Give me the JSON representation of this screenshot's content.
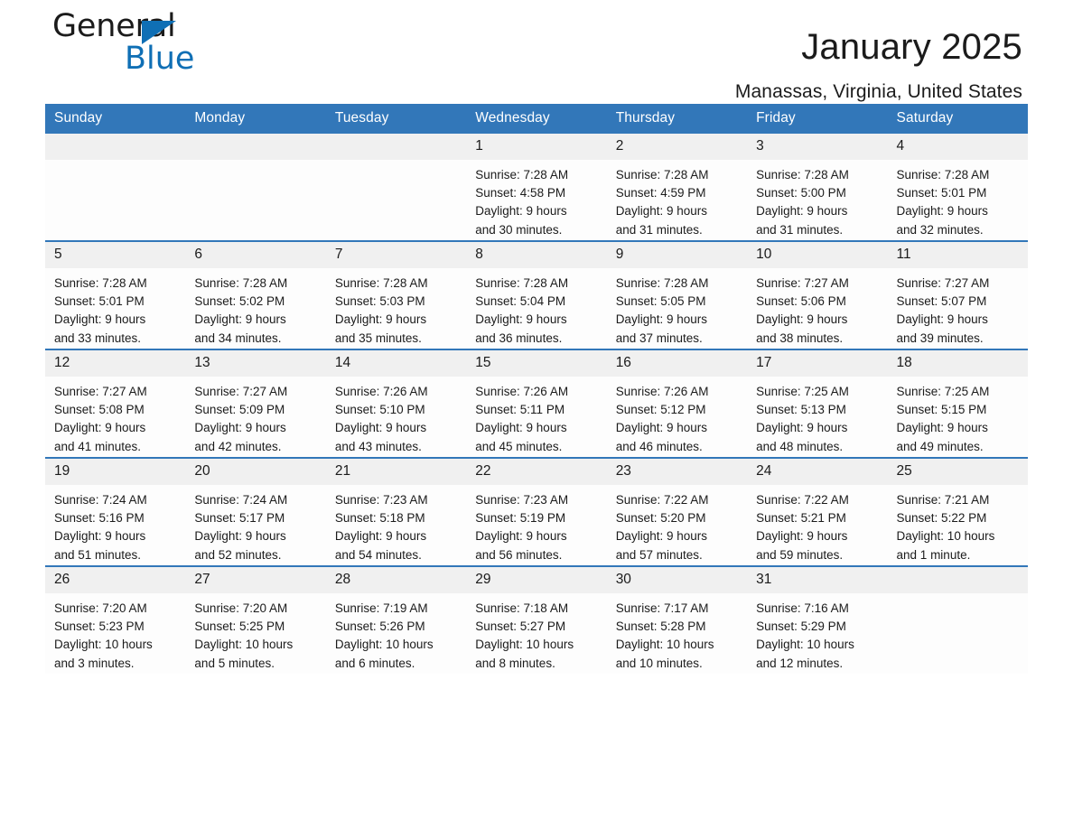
{
  "brand": {
    "name_part1": "General",
    "name_part2": "Blue",
    "triangle_color": "#0f6fb5",
    "text_color": "#1b1b1b"
  },
  "header": {
    "month_title": "January 2025",
    "location": "Manassas, Virginia, United States",
    "header_bg": "#3277b9",
    "header_text": "#ffffff",
    "daynum_bg": "#f0f0f0"
  },
  "weekday_headers": [
    "Sunday",
    "Monday",
    "Tuesday",
    "Wednesday",
    "Thursday",
    "Friday",
    "Saturday"
  ],
  "weeks": [
    [
      {
        "day": "",
        "empty": true,
        "sunrise": "",
        "sunset": "",
        "daylight_line1": "",
        "daylight_line2": ""
      },
      {
        "day": "",
        "empty": true,
        "sunrise": "",
        "sunset": "",
        "daylight_line1": "",
        "daylight_line2": ""
      },
      {
        "day": "",
        "empty": true,
        "sunrise": "",
        "sunset": "",
        "daylight_line1": "",
        "daylight_line2": ""
      },
      {
        "day": "1",
        "empty": false,
        "sunrise": "Sunrise: 7:28 AM",
        "sunset": "Sunset: 4:58 PM",
        "daylight_line1": "Daylight: 9 hours",
        "daylight_line2": "and 30 minutes."
      },
      {
        "day": "2",
        "empty": false,
        "sunrise": "Sunrise: 7:28 AM",
        "sunset": "Sunset: 4:59 PM",
        "daylight_line1": "Daylight: 9 hours",
        "daylight_line2": "and 31 minutes."
      },
      {
        "day": "3",
        "empty": false,
        "sunrise": "Sunrise: 7:28 AM",
        "sunset": "Sunset: 5:00 PM",
        "daylight_line1": "Daylight: 9 hours",
        "daylight_line2": "and 31 minutes."
      },
      {
        "day": "4",
        "empty": false,
        "sunrise": "Sunrise: 7:28 AM",
        "sunset": "Sunset: 5:01 PM",
        "daylight_line1": "Daylight: 9 hours",
        "daylight_line2": "and 32 minutes."
      }
    ],
    [
      {
        "day": "5",
        "empty": false,
        "sunrise": "Sunrise: 7:28 AM",
        "sunset": "Sunset: 5:01 PM",
        "daylight_line1": "Daylight: 9 hours",
        "daylight_line2": "and 33 minutes."
      },
      {
        "day": "6",
        "empty": false,
        "sunrise": "Sunrise: 7:28 AM",
        "sunset": "Sunset: 5:02 PM",
        "daylight_line1": "Daylight: 9 hours",
        "daylight_line2": "and 34 minutes."
      },
      {
        "day": "7",
        "empty": false,
        "sunrise": "Sunrise: 7:28 AM",
        "sunset": "Sunset: 5:03 PM",
        "daylight_line1": "Daylight: 9 hours",
        "daylight_line2": "and 35 minutes."
      },
      {
        "day": "8",
        "empty": false,
        "sunrise": "Sunrise: 7:28 AM",
        "sunset": "Sunset: 5:04 PM",
        "daylight_line1": "Daylight: 9 hours",
        "daylight_line2": "and 36 minutes."
      },
      {
        "day": "9",
        "empty": false,
        "sunrise": "Sunrise: 7:28 AM",
        "sunset": "Sunset: 5:05 PM",
        "daylight_line1": "Daylight: 9 hours",
        "daylight_line2": "and 37 minutes."
      },
      {
        "day": "10",
        "empty": false,
        "sunrise": "Sunrise: 7:27 AM",
        "sunset": "Sunset: 5:06 PM",
        "daylight_line1": "Daylight: 9 hours",
        "daylight_line2": "and 38 minutes."
      },
      {
        "day": "11",
        "empty": false,
        "sunrise": "Sunrise: 7:27 AM",
        "sunset": "Sunset: 5:07 PM",
        "daylight_line1": "Daylight: 9 hours",
        "daylight_line2": "and 39 minutes."
      }
    ],
    [
      {
        "day": "12",
        "empty": false,
        "sunrise": "Sunrise: 7:27 AM",
        "sunset": "Sunset: 5:08 PM",
        "daylight_line1": "Daylight: 9 hours",
        "daylight_line2": "and 41 minutes."
      },
      {
        "day": "13",
        "empty": false,
        "sunrise": "Sunrise: 7:27 AM",
        "sunset": "Sunset: 5:09 PM",
        "daylight_line1": "Daylight: 9 hours",
        "daylight_line2": "and 42 minutes."
      },
      {
        "day": "14",
        "empty": false,
        "sunrise": "Sunrise: 7:26 AM",
        "sunset": "Sunset: 5:10 PM",
        "daylight_line1": "Daylight: 9 hours",
        "daylight_line2": "and 43 minutes."
      },
      {
        "day": "15",
        "empty": false,
        "sunrise": "Sunrise: 7:26 AM",
        "sunset": "Sunset: 5:11 PM",
        "daylight_line1": "Daylight: 9 hours",
        "daylight_line2": "and 45 minutes."
      },
      {
        "day": "16",
        "empty": false,
        "sunrise": "Sunrise: 7:26 AM",
        "sunset": "Sunset: 5:12 PM",
        "daylight_line1": "Daylight: 9 hours",
        "daylight_line2": "and 46 minutes."
      },
      {
        "day": "17",
        "empty": false,
        "sunrise": "Sunrise: 7:25 AM",
        "sunset": "Sunset: 5:13 PM",
        "daylight_line1": "Daylight: 9 hours",
        "daylight_line2": "and 48 minutes."
      },
      {
        "day": "18",
        "empty": false,
        "sunrise": "Sunrise: 7:25 AM",
        "sunset": "Sunset: 5:15 PM",
        "daylight_line1": "Daylight: 9 hours",
        "daylight_line2": "and 49 minutes."
      }
    ],
    [
      {
        "day": "19",
        "empty": false,
        "sunrise": "Sunrise: 7:24 AM",
        "sunset": "Sunset: 5:16 PM",
        "daylight_line1": "Daylight: 9 hours",
        "daylight_line2": "and 51 minutes."
      },
      {
        "day": "20",
        "empty": false,
        "sunrise": "Sunrise: 7:24 AM",
        "sunset": "Sunset: 5:17 PM",
        "daylight_line1": "Daylight: 9 hours",
        "daylight_line2": "and 52 minutes."
      },
      {
        "day": "21",
        "empty": false,
        "sunrise": "Sunrise: 7:23 AM",
        "sunset": "Sunset: 5:18 PM",
        "daylight_line1": "Daylight: 9 hours",
        "daylight_line2": "and 54 minutes."
      },
      {
        "day": "22",
        "empty": false,
        "sunrise": "Sunrise: 7:23 AM",
        "sunset": "Sunset: 5:19 PM",
        "daylight_line1": "Daylight: 9 hours",
        "daylight_line2": "and 56 minutes."
      },
      {
        "day": "23",
        "empty": false,
        "sunrise": "Sunrise: 7:22 AM",
        "sunset": "Sunset: 5:20 PM",
        "daylight_line1": "Daylight: 9 hours",
        "daylight_line2": "and 57 minutes."
      },
      {
        "day": "24",
        "empty": false,
        "sunrise": "Sunrise: 7:22 AM",
        "sunset": "Sunset: 5:21 PM",
        "daylight_line1": "Daylight: 9 hours",
        "daylight_line2": "and 59 minutes."
      },
      {
        "day": "25",
        "empty": false,
        "sunrise": "Sunrise: 7:21 AM",
        "sunset": "Sunset: 5:22 PM",
        "daylight_line1": "Daylight: 10 hours",
        "daylight_line2": "and 1 minute."
      }
    ],
    [
      {
        "day": "26",
        "empty": false,
        "sunrise": "Sunrise: 7:20 AM",
        "sunset": "Sunset: 5:23 PM",
        "daylight_line1": "Daylight: 10 hours",
        "daylight_line2": "and 3 minutes."
      },
      {
        "day": "27",
        "empty": false,
        "sunrise": "Sunrise: 7:20 AM",
        "sunset": "Sunset: 5:25 PM",
        "daylight_line1": "Daylight: 10 hours",
        "daylight_line2": "and 5 minutes."
      },
      {
        "day": "28",
        "empty": false,
        "sunrise": "Sunrise: 7:19 AM",
        "sunset": "Sunset: 5:26 PM",
        "daylight_line1": "Daylight: 10 hours",
        "daylight_line2": "and 6 minutes."
      },
      {
        "day": "29",
        "empty": false,
        "sunrise": "Sunrise: 7:18 AM",
        "sunset": "Sunset: 5:27 PM",
        "daylight_line1": "Daylight: 10 hours",
        "daylight_line2": "and 8 minutes."
      },
      {
        "day": "30",
        "empty": false,
        "sunrise": "Sunrise: 7:17 AM",
        "sunset": "Sunset: 5:28 PM",
        "daylight_line1": "Daylight: 10 hours",
        "daylight_line2": "and 10 minutes."
      },
      {
        "day": "31",
        "empty": false,
        "sunrise": "Sunrise: 7:16 AM",
        "sunset": "Sunset: 5:29 PM",
        "daylight_line1": "Daylight: 10 hours",
        "daylight_line2": "and 12 minutes."
      },
      {
        "day": "",
        "empty": true,
        "sunrise": "",
        "sunset": "",
        "daylight_line1": "",
        "daylight_line2": ""
      }
    ]
  ]
}
